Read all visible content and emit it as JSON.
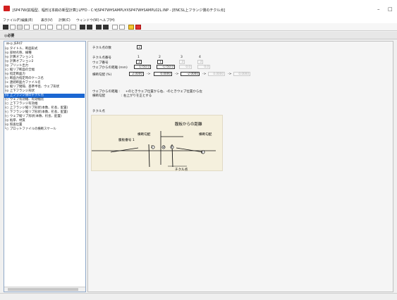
{
  "window": {
    "title": "JSP47W(拡幅型、幅形)[本冊の新型計算] LFFD - C:¥JSP47W¥SAMPL¥XSP47W¥SAMPL02L.INP - [ENCSL上フランジ側のチクル点]",
    "buttons": [
      "–",
      "□"
    ]
  },
  "menu": [
    "ファイル(F)",
    "編集(E)",
    "表示(V)",
    "計算(C)",
    "ウィンドウ(W)",
    "ヘルプ(H)"
  ],
  "header": {
    "label": "◎必要"
  },
  "tree": {
    "root": "⊟-◎ JSP47",
    "items": [
      "├◎ タイトル、断面形式",
      "├◎ 部材名称、線種",
      "├◎ 計算オプション1",
      "├◎ 計算オプション2",
      "├◎ プリント出力",
      "├○ 縦リブ断面の全幅",
      "├◎ 指定断面力",
      "├○ 断面力指定時のケース名",
      "├× 連続断面力ファイル名",
      "├◎ 縦リブ間隔、基準半径、ウェブ形状",
      "├◎ 上下フランジ形状",
      "├◎ 上フランジ側のチクル点",
      "├○ ウェブ有効幅、有効幅比",
      "├○ 上下フランジ有効幅",
      "├○ 上フランジ縦リブ形状(本数、桁長、配置)",
      "├○ 下フランジ縦リブ形状(本数、桁長、配置)",
      "├○ ウェブ縦リブ形状(本数、桁長、配置)",
      "├◎ 板厚、材質",
      "├◎ 照査位置",
      "└○ プロットファイルの横断スケール"
    ],
    "selected_index": 11
  },
  "form": {
    "num_points_label": "チクル点の数",
    "num_points_value": "2",
    "point_no_label": "チクル点番号",
    "point_numbers": [
      "1",
      "2",
      "3",
      "4"
    ],
    "web_no_label": "ウェブ番号",
    "web_numbers": [
      "2",
      "1",
      "3",
      "3"
    ],
    "distance_label": "ウェブからの距離 (mm)",
    "distance_values": [
      "1750.0",
      "-1750.0",
      "0.0",
      "0.0"
    ],
    "slope_label": "横断勾配 (%)",
    "slope_values": [
      "2.0000",
      "0.0000",
      "-2.0000",
      "0.0000",
      "0.0000"
    ],
    "arrows": [
      "->",
      "->",
      "->",
      "->"
    ],
    "note1_label": "ウェブからの距離 :",
    "note1_text": "+のときウェブ位置から右、-のときウェブ位置から左",
    "note2_label": "横断勾配",
    "note2_text": ": 右上がりを正とする"
  },
  "diagram": {
    "section_label": "チクル点",
    "distance_title": "腹板からの距離",
    "slope_left": "横断勾配",
    "slope_right": "横断勾配",
    "web_no": "腹板番号 1",
    "point_name": "チクル点",
    "marks": [
      "1",
      "2",
      "3",
      "4"
    ]
  }
}
